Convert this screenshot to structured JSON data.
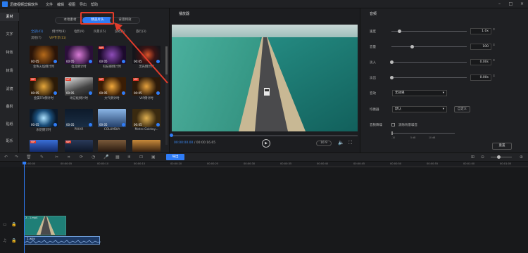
{
  "app": {
    "title": "迅捷视频剪辑软件"
  },
  "menu": [
    "文件",
    "编辑",
    "视图",
    "导出",
    "帮助"
  ],
  "window_controls": [
    "minimize",
    "maximize",
    "close"
  ],
  "left_tabs": [
    {
      "label": "素材",
      "active": true
    },
    {
      "label": "文字",
      "active": false
    },
    {
      "label": "特效",
      "active": false
    },
    {
      "label": "转场",
      "active": false
    },
    {
      "label": "滤镜",
      "active": false
    },
    {
      "label": "叠附",
      "active": false
    },
    {
      "label": "贴纸",
      "active": false
    },
    {
      "label": "配乐",
      "active": false
    }
  ],
  "library": {
    "segments": [
      "本地素材",
      "精美片头",
      "背景特效"
    ],
    "active_segment": "精美片头",
    "categories_row1": [
      "全部(41)",
      "倒计时(8)",
      "电影(9)",
      "风景(15)",
      "游戏(5)",
      "旅行(3)"
    ],
    "categories_row2": [
      "其他(7)",
      "VIP专享(11)"
    ],
    "items": [
      {
        "label": "金色火焰倒计时",
        "duration": "00:05",
        "vip": false
      },
      {
        "label": "电流倒计时",
        "duration": "00:05",
        "vip": false
      },
      {
        "label": "科技感倒计时",
        "duration": "00:05",
        "vip": true
      },
      {
        "label": "灵光倒计时",
        "duration": "00:05",
        "vip": false
      },
      {
        "label": "金属FRI倒计时",
        "duration": "00:05",
        "vip": true
      },
      {
        "label": "场记板倒计时",
        "duration": "00:05",
        "vip": false
      },
      {
        "label": "大气倒计时",
        "duration": "00:05",
        "vip": true
      },
      {
        "label": "VIP倒计时",
        "duration": "00:05",
        "vip": true
      },
      {
        "label": "水花倒计时",
        "duration": "00:05",
        "vip": false
      },
      {
        "label": "PIXAR",
        "duration": "00:05",
        "vip": false
      },
      {
        "label": "COLUMBIA",
        "duration": "00:05",
        "vip": false
      },
      {
        "label": "Metro Goldwy...",
        "duration": "00:05",
        "vip": false
      },
      {
        "label": "",
        "duration": "",
        "vip": true
      },
      {
        "label": "",
        "duration": "",
        "vip": true
      },
      {
        "label": "",
        "duration": "",
        "vip": false
      },
      {
        "label": "",
        "duration": "",
        "vip": false
      }
    ]
  },
  "player": {
    "title": "播放器",
    "time_current": "00:00:00.00",
    "time_total": "/ 00:00:16.65",
    "ratio": "16:9",
    "progress": 0.0
  },
  "props": {
    "title": "音频",
    "speed": {
      "label": "速度",
      "value": "1.0x",
      "level": 0.1
    },
    "volume": {
      "label": "音量",
      "value": "100",
      "level": 0.25
    },
    "fade_in": {
      "label": "淡入",
      "value": "0.00s",
      "level": 0.0
    },
    "fade_out": {
      "label": "淡出",
      "value": "0.00s",
      "level": 0.0
    },
    "voice_change": {
      "label": "音效",
      "value": "无效果"
    },
    "equalizer": {
      "label": "均衡器",
      "value": "默认",
      "custom": "自定义"
    },
    "denoise": {
      "label": "音频降噪",
      "checkbox_label": "消除背景噪音",
      "checked": false
    },
    "scale": [
      "-10",
      "",
      "5 dB",
      "",
      "10 dB"
    ],
    "reset": "重置"
  },
  "toolbar": {
    "export": "导出"
  },
  "timeline": {
    "ticks": [
      "00:00:00",
      "00:00:05",
      "00:00:10",
      "00:00:15",
      "00:00:20",
      "00:00:25",
      "00:00:30",
      "00:00:35",
      "00:00:40",
      "00:00:45",
      "00:00:50",
      "00:00:55",
      "00:01:00",
      "00:01:05"
    ],
    "video_clip": "2 - 1.mp4",
    "audio_clip": "1.wav"
  },
  "colors": {
    "accent": "#2f7cf6",
    "highlight": "#e23c2b"
  }
}
